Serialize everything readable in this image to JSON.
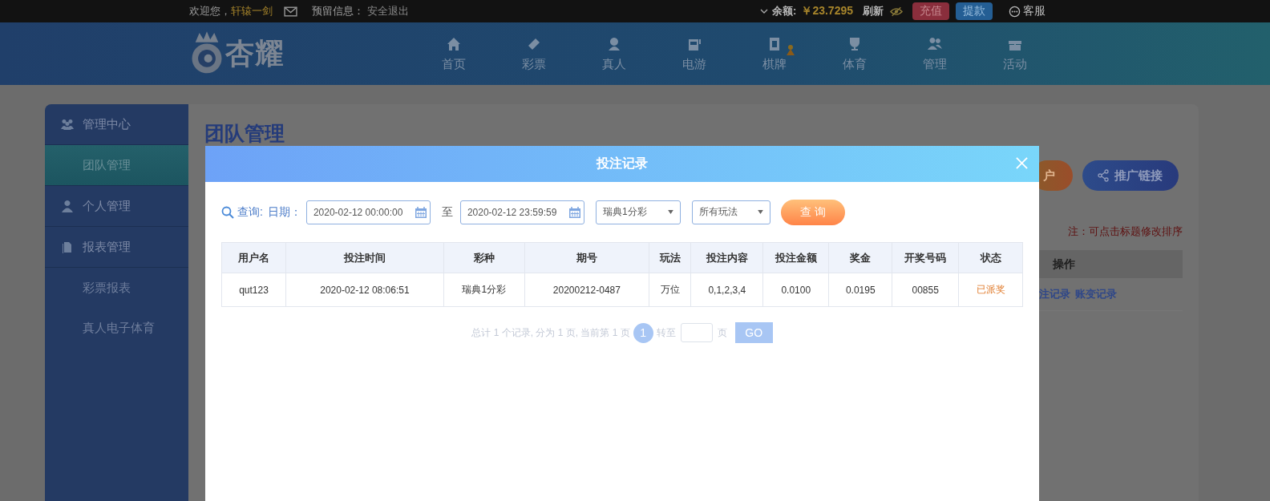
{
  "top_bar": {
    "welcome": "欢迎您，",
    "username": "轩辕一剑",
    "reserved_label": "预留信息：",
    "logout": "安全退出",
    "balance_label": "余额:",
    "balance": "￥23.7295",
    "refresh": "刷新",
    "recharge": "充值",
    "withdraw": "提款",
    "service": "客服"
  },
  "logo": {
    "text": "杏耀"
  },
  "nav": [
    {
      "label": "首页"
    },
    {
      "label": "彩票"
    },
    {
      "label": "真人"
    },
    {
      "label": "电游"
    },
    {
      "label": "棋牌"
    },
    {
      "label": "体育"
    },
    {
      "label": "管理"
    },
    {
      "label": "活动"
    }
  ],
  "sidebar": [
    {
      "label": "管理中心",
      "children": [
        {
          "label": "团队管理",
          "selected": true
        }
      ]
    },
    {
      "label": "个人管理"
    },
    {
      "label": "报表管理",
      "children": [
        {
          "label": "彩票报表",
          "selected": false
        },
        {
          "label": "真人电子体育",
          "selected": false
        }
      ]
    }
  ],
  "page": {
    "title": "团队管理",
    "open_account_button": "户",
    "promo_button": "推广链接",
    "note": "注：可点击标题修改排序",
    "column": "操作",
    "links": [
      "注记录",
      "账变记录"
    ]
  },
  "modal": {
    "title": "投注记录",
    "query": {
      "label": "查询:",
      "date_label": "日期：",
      "start": "2020-02-12 00:00:00",
      "separator": "至",
      "end": "2020-02-12 23:59:59",
      "lottery": "瑞典1分彩",
      "play": "所有玩法",
      "button": "查 询"
    },
    "table": {
      "columns": [
        "用户名",
        "投注时间",
        "彩种",
        "期号",
        "玩法",
        "投注内容",
        "投注金额",
        "奖金",
        "开奖号码",
        "状态"
      ],
      "rows": [
        [
          "qut123",
          "2020-02-12 08:06:51",
          "瑞典1分彩",
          "20200212-0487",
          "万位",
          "0,1,2,3,4",
          "0.0100",
          "0.0195",
          "00855",
          "已派奖"
        ]
      ]
    },
    "pagination": {
      "summary": "总计 1 个记录, 分为 1 页, 当前第 1 页",
      "current": "1",
      "goto": "转至",
      "unit": "页",
      "go": "GO"
    }
  }
}
